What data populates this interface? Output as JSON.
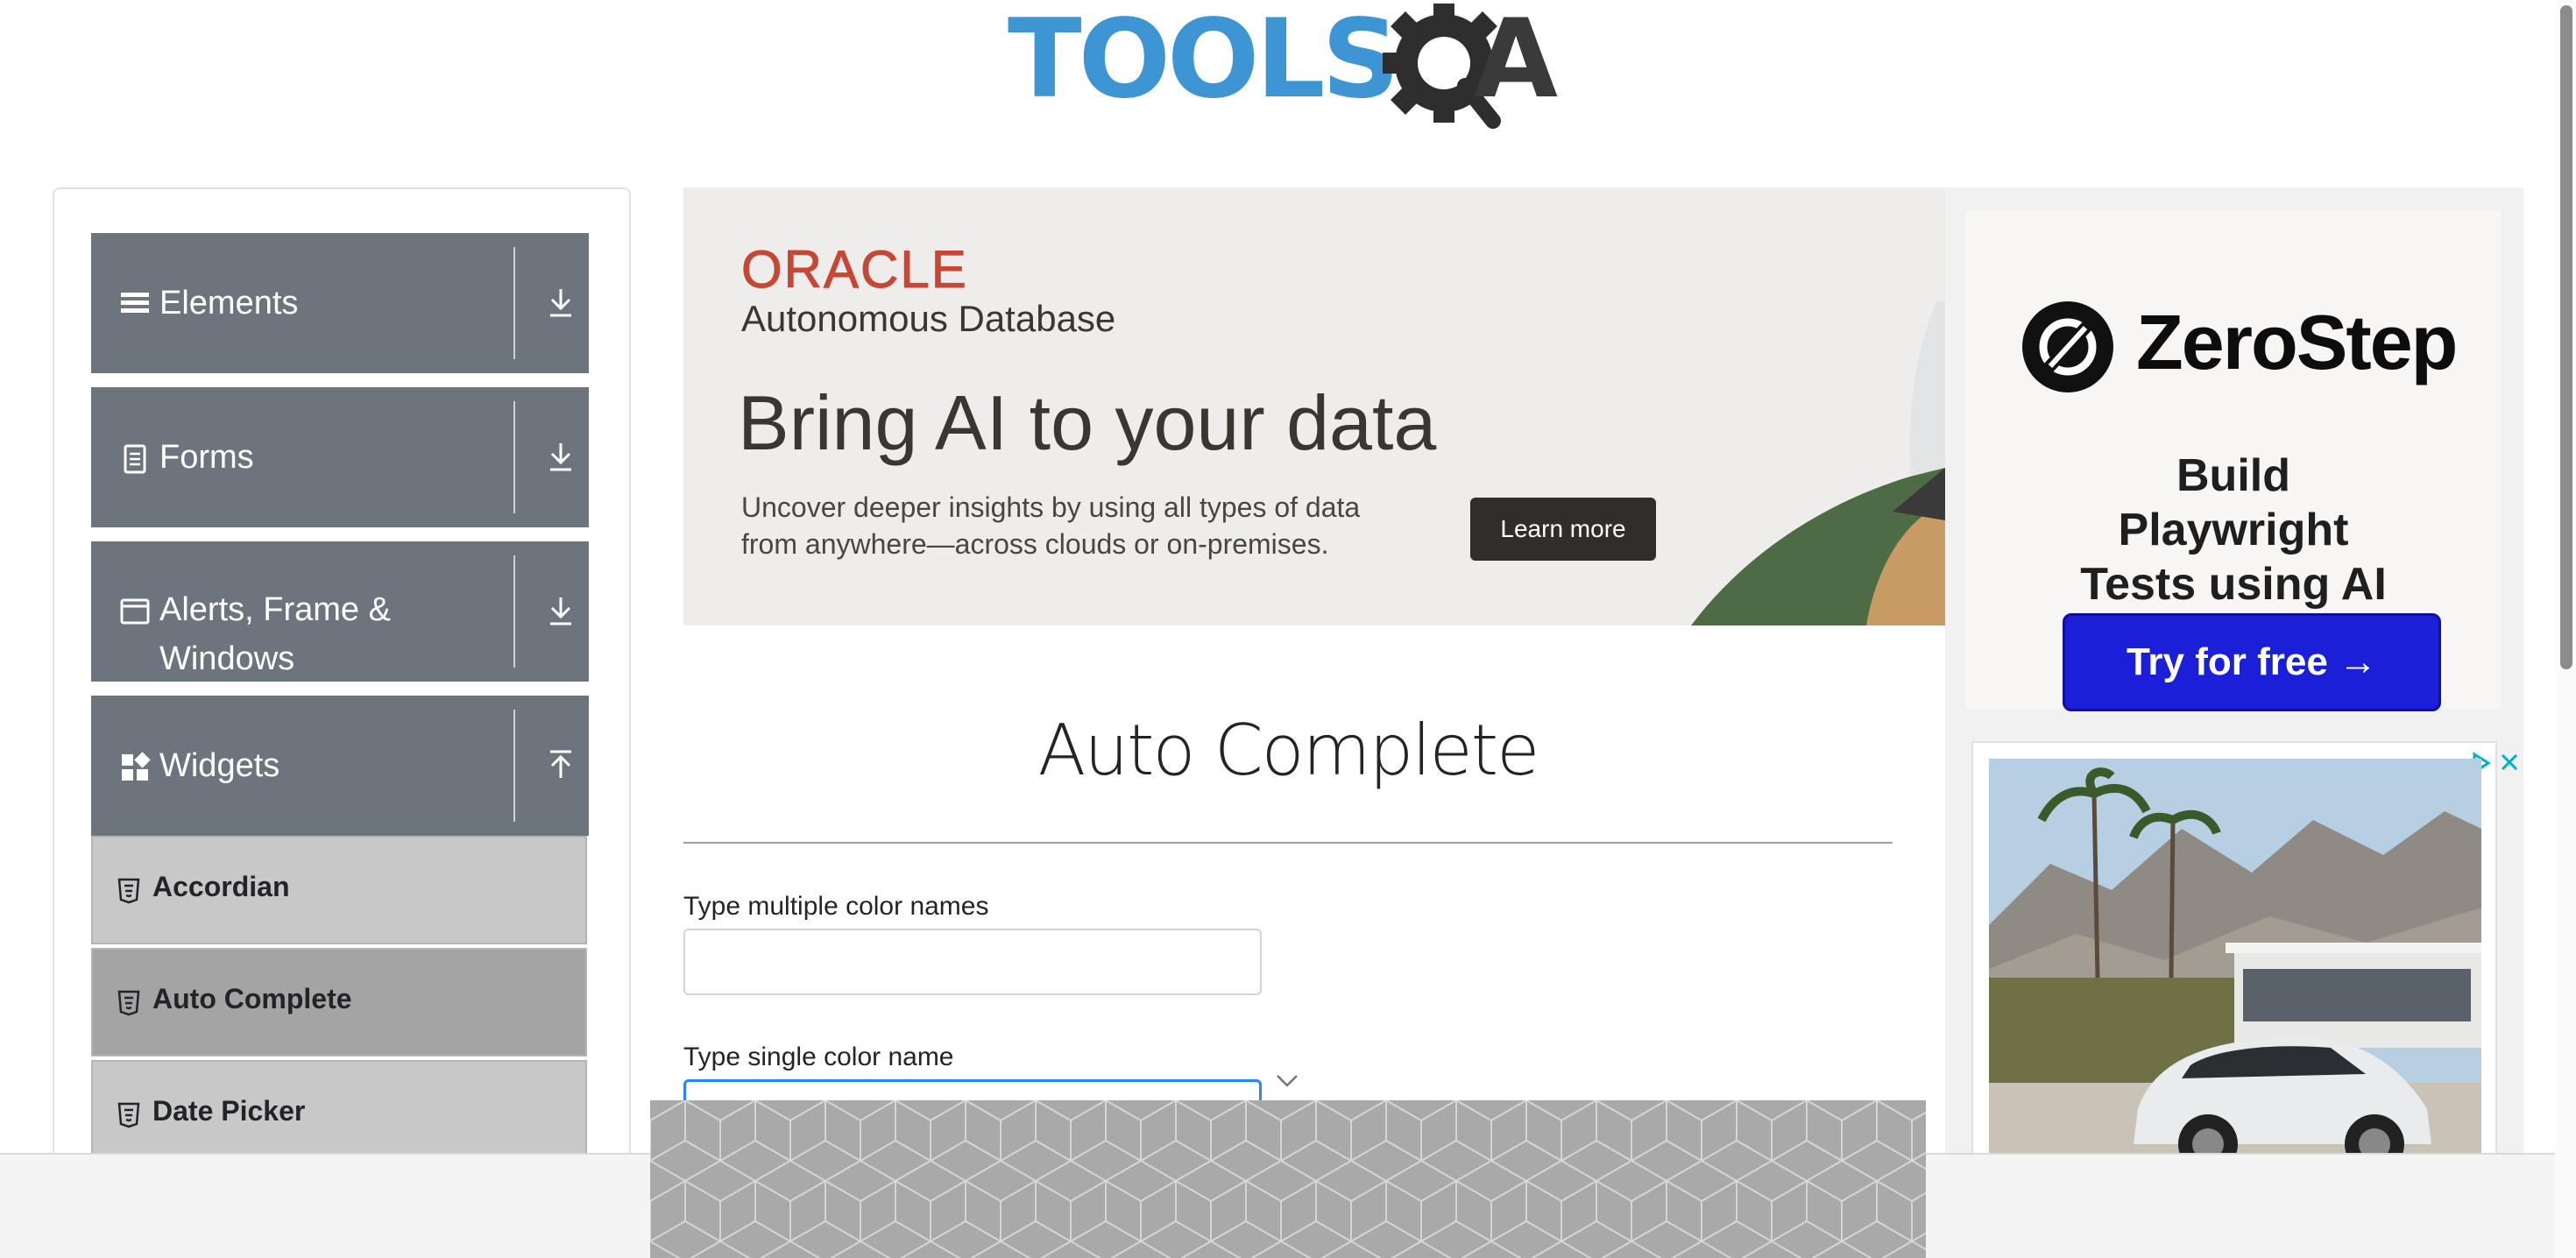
{
  "header": {
    "logo_main": "TOOLS",
    "logo_tail": "A"
  },
  "sidebar": {
    "groups": [
      {
        "label": "Elements",
        "icon": "hamburger-icon",
        "arrow": "download-arrow-icon"
      },
      {
        "label": "Forms",
        "icon": "document-icon",
        "arrow": "download-arrow-icon"
      },
      {
        "label": "Alerts, Frame & Windows",
        "icon": "window-icon",
        "arrow": "download-arrow-icon"
      },
      {
        "label": "Widgets",
        "icon": "widgets-icon",
        "arrow": "upload-arrow-icon"
      }
    ],
    "items": [
      {
        "label": "Accordian",
        "icon": "html5-icon",
        "active": false
      },
      {
        "label": "Auto Complete",
        "icon": "html5-icon",
        "active": true
      },
      {
        "label": "Date Picker",
        "icon": "html5-icon",
        "active": false
      }
    ]
  },
  "oracle_ad": {
    "brand": "ORACLE",
    "product": "Autonomous  Database",
    "headline": "Bring AI to your data",
    "body": "Uncover deeper insights by using all types of data from anywhere—across clouds or on-premises.",
    "cta": "Learn more",
    "colors": {
      "brand": "#c74634",
      "button": "#312d2a"
    }
  },
  "main": {
    "title": "Auto Complete",
    "multiple_label": "Type multiple color names",
    "multiple_value": "",
    "single_label": "Type single color name",
    "single_value": ""
  },
  "zerostep_ad": {
    "brand": "ZeroStep",
    "tagline": "Build Playwright Tests using AI",
    "cta": "Try for free →",
    "colors": {
      "button": "#1b1fd8"
    }
  },
  "car_ad": {
    "adchoices_icon": "adchoices-icon",
    "close_icon": "close-icon"
  }
}
